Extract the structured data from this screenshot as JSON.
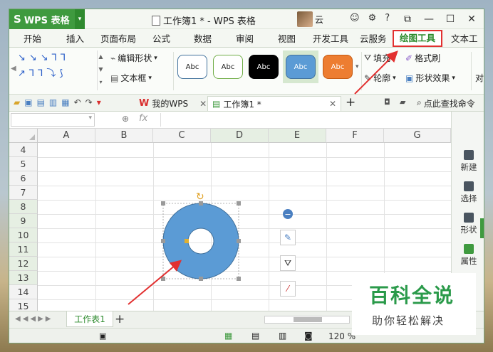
{
  "app": {
    "name": "WPS 表格",
    "logo_glyph": "S",
    "caret": "▾"
  },
  "title": "工作簿1 * - WPS 表格",
  "user": "云",
  "window_controls": [
    "⧉",
    "—",
    "☐",
    "✕"
  ],
  "menu_tabs": [
    "开始",
    "插入",
    "页面布局",
    "公式",
    "数据",
    "审阅",
    "视图",
    "开发工具",
    "云服务",
    "绘图工具",
    "文本工"
  ],
  "active_tab": "绘图工具",
  "ribbon": {
    "edit_shape": "编辑形状",
    "text_box": "文本框",
    "style_labels": [
      "Abc",
      "Abc",
      "Abc",
      "Abc",
      "Abc"
    ],
    "fill": "填充",
    "outline": "轮廓",
    "format_painter": "格式刷",
    "shape_effects": "形状效果",
    "align": "对"
  },
  "doc_tabs": {
    "mywps": "我的WPS",
    "workbook": "工作簿1 *",
    "find_command": "点此查找命令"
  },
  "formula": {
    "fx": "fx"
  },
  "columns": [
    "A",
    "B",
    "C",
    "D",
    "E",
    "F",
    "G"
  ],
  "rows": [
    "4",
    "5",
    "6",
    "7",
    "8",
    "9",
    "10",
    "11",
    "12",
    "13",
    "14",
    "15"
  ],
  "right_panel": [
    "新建",
    "选择",
    "形状",
    "属性"
  ],
  "sheet_tab": "工作表1",
  "zoom": "120 %",
  "watermark": {
    "line1": "百科全说",
    "line2": "助你轻松解决"
  },
  "colors": {
    "accent": "#3f9a3f",
    "highlight": "#e23030",
    "donut": "#5b9bd5",
    "donut_stroke": "#41719c"
  }
}
